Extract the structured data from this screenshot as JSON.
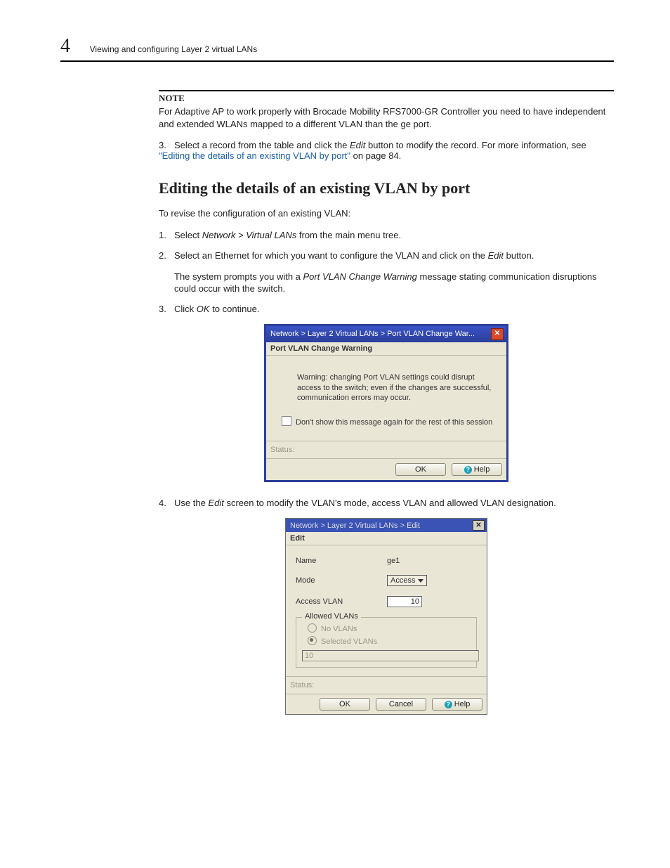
{
  "header": {
    "chapter": "4",
    "running_title": "Viewing and configuring Layer 2 virtual LANs"
  },
  "note": {
    "label": "NOTE",
    "text": "For Adaptive AP to work properly with Brocade Mobility RFS7000-GR Controller you need to have independent and extended WLANs mapped to a different VLAN than the ge port."
  },
  "step3_top": {
    "num": "3.",
    "text_a": "Select a record from the table and click the ",
    "italic1": "Edit",
    "text_b": " button to modify the record. For more information, see ",
    "link": "\"Editing the details of an existing VLAN by port\"",
    "text_c": " on page 84."
  },
  "section_heading": "Editing the details of an existing VLAN by port",
  "intro": "To revise the configuration of an existing VLAN:",
  "step1": {
    "num": "1.",
    "text_a": "Select ",
    "italic": "Network > Virtual LANs",
    "text_b": " from the main menu tree."
  },
  "step2": {
    "num": "2.",
    "text_a": "Select an Ethernet for which you want to configure the VLAN and click on the ",
    "italic": "Edit",
    "text_b": " button.",
    "follow_a": "The system prompts you with a ",
    "follow_italic": "Port VLAN Change Warning",
    "follow_b": " message stating communication disruptions could occur with the switch."
  },
  "step3": {
    "num": "3.",
    "text_a": "Click ",
    "italic": "OK",
    "text_b": " to continue."
  },
  "dialog_warning": {
    "title": "Network > Layer 2 Virtual LANs > Port VLAN Change War...",
    "section": "Port VLAN Change Warning",
    "body": "Warning: changing Port VLAN settings could disrupt access to the switch; even if the changes are successful, communication errors may occur.",
    "checkbox_label": "Don't show this message again for the rest of this session",
    "status_label": "Status:",
    "ok": "OK",
    "help": "Help"
  },
  "step4": {
    "num": "4.",
    "text_a": "Use the ",
    "italic": "Edit",
    "text_b": " screen to modify the VLAN's mode, access VLAN and allowed VLAN designation."
  },
  "dialog_edit": {
    "title": "Network > Layer 2 Virtual LANs > Edit",
    "section": "Edit",
    "name_label": "Name",
    "name_value": "ge1",
    "mode_label": "Mode",
    "mode_value": "Access",
    "access_label": "Access VLAN",
    "access_value": "10",
    "allowed_legend": "Allowed VLANs",
    "radio_no": "No VLANs",
    "radio_selected": "Selected VLANs",
    "selected_value": "10",
    "status_label": "Status:",
    "ok": "OK",
    "cancel": "Cancel",
    "help": "Help"
  }
}
